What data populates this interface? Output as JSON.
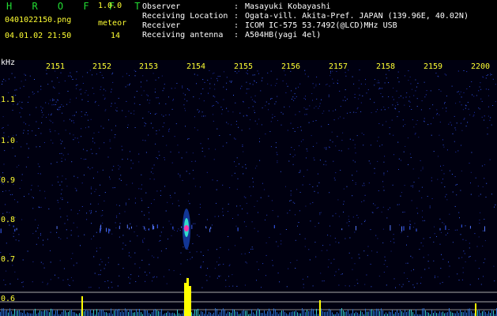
{
  "app": {
    "title": "H R O F F T",
    "version": "1.0.0"
  },
  "file": {
    "name": "0401022150.png",
    "datetime": "04.01.02 21:50"
  },
  "meteor": {
    "label": "meteor",
    "count": "14"
  },
  "info": [
    {
      "label": "Observer",
      "value": "Masayuki Kobayashi"
    },
    {
      "label": "Receiving Location",
      "value": "Ogata-vill. Akita-Pref. JAPAN (139.96E, 40.02N)"
    },
    {
      "label": "Receiver",
      "value": "ICOM IC-575 53.7492(@LCD)MHz USB"
    },
    {
      "label": "Receiving antenna",
      "value": "A504HB(yagi 4el)"
    }
  ],
  "spectrogram": {
    "unit_label": "kHz",
    "x_ticks": [
      "2151",
      "2152",
      "2153",
      "2154",
      "2155",
      "2156",
      "2157",
      "2158",
      "2159",
      "2200"
    ],
    "y_ticks": [
      "1.1",
      "1.0",
      "0.9",
      "0.8",
      "0.7",
      "0.6"
    ]
  },
  "colors": {
    "header_text": "#ffffff",
    "title": "#22dd33",
    "label": "#ffff33",
    "background": "#000010",
    "noise": "#2233cc",
    "meteor": "#ffff00"
  }
}
